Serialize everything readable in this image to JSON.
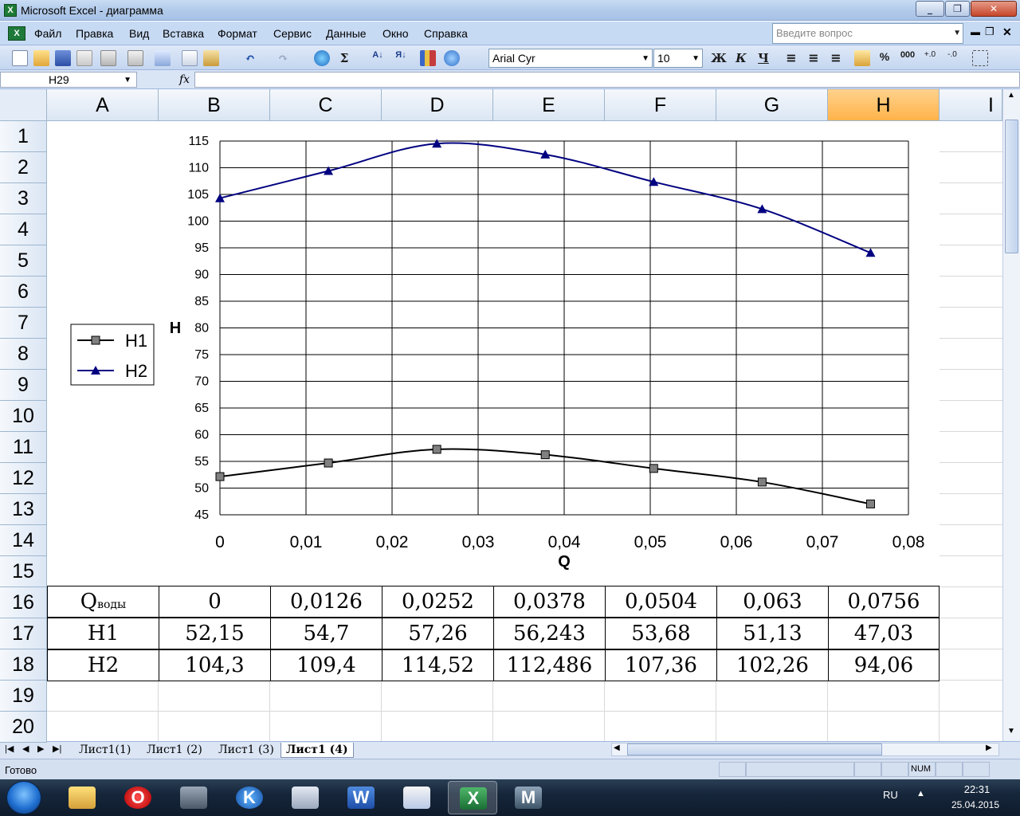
{
  "window": {
    "title": "Microsoft Excel - диаграмма",
    "app_icon": "X"
  },
  "menu": {
    "items": [
      "Файл",
      "Правка",
      "Вид",
      "Вставка",
      "Формат",
      "Сервис",
      "Данные",
      "Окно",
      "Справка"
    ],
    "ask_placeholder": "Введите вопрос"
  },
  "toolbar": {
    "font_name": "Arial Cyr",
    "font_size": "10",
    "bold_label": "Ж",
    "italic_label": "К",
    "underline_label": "Ч",
    "percent_label": "%",
    "thousands_label": "000",
    "sum_label": "Σ"
  },
  "formula_bar": {
    "name_box": "H29",
    "fx_label": "fx",
    "value": ""
  },
  "grid": {
    "columns": [
      "A",
      "B",
      "C",
      "D",
      "E",
      "F",
      "G",
      "H",
      "I"
    ],
    "active_column": "H",
    "rows": [
      "1",
      "2",
      "3",
      "4",
      "5",
      "6",
      "7",
      "8",
      "9",
      "10",
      "11",
      "12",
      "13",
      "14",
      "15",
      "16",
      "17",
      "18",
      "19",
      "20"
    ]
  },
  "table": {
    "header_label": "Q",
    "header_sub": "воды",
    "q_values": [
      "0",
      "0,0126",
      "0,0252",
      "0,0378",
      "0,0504",
      "0,063",
      "0,0756"
    ],
    "h1_label": "H1",
    "h1_values": [
      "52,15",
      "54,7",
      "57,26",
      "56,243",
      "53,68",
      "51,13",
      "47,03"
    ],
    "h2_label": "H2",
    "h2_values": [
      "104,3",
      "109,4",
      "114,52",
      "112,486",
      "107,36",
      "102,26",
      "94,06"
    ]
  },
  "chart_data": {
    "type": "line",
    "xlabel": "Q",
    "ylabel": "H",
    "xlim": [
      0,
      0.08
    ],
    "ylim": [
      45,
      115
    ],
    "x_ticks": [
      "0",
      "0,01",
      "0,02",
      "0,03",
      "0,04",
      "0,05",
      "0,06",
      "0,07",
      "0,08"
    ],
    "y_ticks": [
      "45",
      "50",
      "55",
      "60",
      "65",
      "70",
      "75",
      "80",
      "85",
      "90",
      "95",
      "100",
      "105",
      "110",
      "115"
    ],
    "grid": true,
    "legend_position": "left",
    "x": [
      0,
      0.0126,
      0.0252,
      0.0378,
      0.0504,
      0.063,
      0.0756
    ],
    "series": [
      {
        "name": "H1",
        "values": [
          52.15,
          54.7,
          57.26,
          56.243,
          53.68,
          51.13,
          47.03
        ],
        "marker": "square",
        "color": "#000000"
      },
      {
        "name": "H2",
        "values": [
          104.3,
          109.4,
          114.52,
          112.486,
          107.36,
          102.26,
          94.06
        ],
        "marker": "triangle",
        "color": "#000080"
      }
    ]
  },
  "sheets": {
    "tabs": [
      "Лист1(1)",
      "Лист1 (2)",
      "Лист1 (3)",
      "Лист1 (4)"
    ],
    "active": "Лист1 (4)"
  },
  "status": {
    "ready": "Готово",
    "num": "NUM"
  },
  "taskbar": {
    "apps": [
      "explorer-icon",
      "opera-icon",
      "computer-icon",
      "k-browser-icon",
      "calculator-icon",
      "word-icon",
      "pen-icon",
      "excel-icon",
      "mathcad-icon"
    ],
    "lang": "RU",
    "time": "22:31",
    "date": "25.04.2015"
  }
}
